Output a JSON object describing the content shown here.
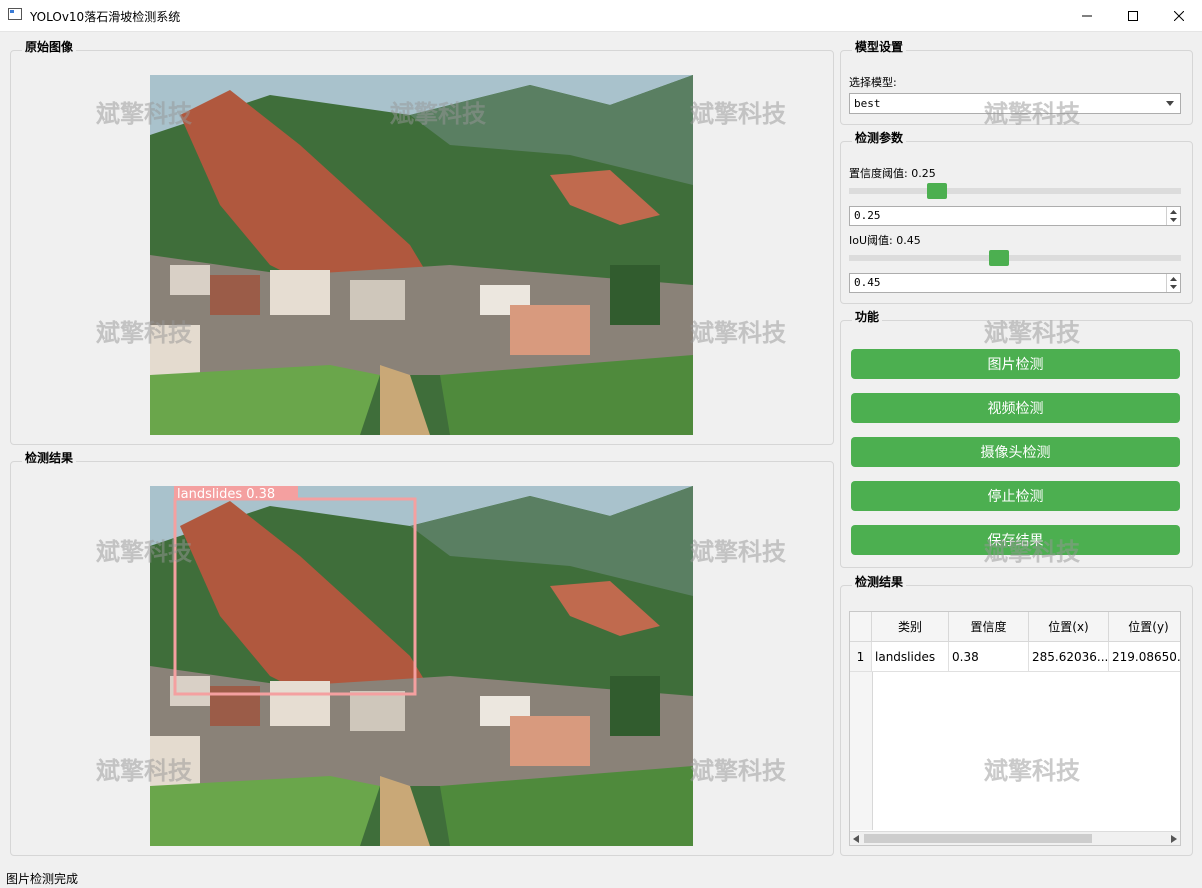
{
  "window": {
    "title": "YOLOv10落石滑坡检测系统"
  },
  "original_panel": {
    "title": "原始图像"
  },
  "result_panel": {
    "title": "检测结果",
    "detection_label": "landslides  0.38"
  },
  "model_settings": {
    "title": "模型设置",
    "select_label": "选择模型:",
    "selected_model": "best"
  },
  "params": {
    "title": "检测参数",
    "conf_label": "置信度阈值: 0.25",
    "conf_value": "0.25",
    "conf_level": 0.25,
    "iou_label": "IoU阈值: 0.45",
    "iou_value": "0.45",
    "iou_level": 0.45
  },
  "functions": {
    "title": "功能",
    "buttons": [
      "图片检测",
      "视频检测",
      "摄像头检测",
      "停止检测",
      "保存结果"
    ]
  },
  "results_table": {
    "title": "检测结果",
    "headers": [
      "类别",
      "置信度",
      "位置(x)",
      "位置(y)"
    ],
    "rows": [
      {
        "index": "1",
        "cells": [
          "landslides",
          "0.38",
          "285.62036...",
          "219.08650..."
        ]
      }
    ]
  },
  "watermark": "斌擎科技",
  "status": "图片检测完成",
  "colors": {
    "accent_green": "#4caf50",
    "box_color": "#f4a0a0"
  }
}
